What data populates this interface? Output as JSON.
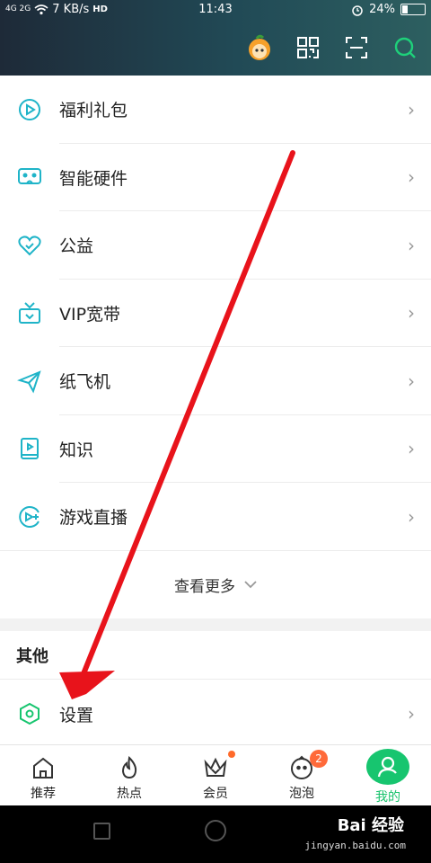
{
  "status": {
    "network": "4G 2G",
    "speed": "7 KB/s",
    "hd": "HD",
    "time": "11:43",
    "battery": "24%"
  },
  "header": {
    "icons": [
      "avatar-icon",
      "qr-code-icon",
      "scan-icon",
      "search-icon"
    ]
  },
  "menu": {
    "items": [
      {
        "label": "福利礼包",
        "icon": "gift-play-icon"
      },
      {
        "label": "智能硬件",
        "icon": "vr-glasses-icon"
      },
      {
        "label": "公益",
        "icon": "heart-hands-icon"
      },
      {
        "label": "VIP宽带",
        "icon": "broadband-icon"
      },
      {
        "label": "纸飞机",
        "icon": "paper-plane-icon"
      },
      {
        "label": "知识",
        "icon": "book-icon"
      },
      {
        "label": "游戏直播",
        "icon": "game-live-icon"
      }
    ],
    "more_label": "查看更多"
  },
  "other": {
    "title": "其他",
    "settings_label": "设置"
  },
  "tabs": [
    {
      "label": "推荐",
      "icon": "home-icon"
    },
    {
      "label": "热点",
      "icon": "fire-icon"
    },
    {
      "label": "会员",
      "icon": "crown-icon"
    },
    {
      "label": "泡泡",
      "icon": "bubble-face-icon",
      "badge": "2"
    },
    {
      "label": "我的",
      "icon": "profile-icon"
    }
  ],
  "watermark": {
    "brand": "Bai 经验",
    "url": "jingyan.baidu.com"
  },
  "colors": {
    "accent": "#17c56f",
    "icon_teal": "#1fb4c8",
    "annotation_arrow": "#e8131b"
  }
}
